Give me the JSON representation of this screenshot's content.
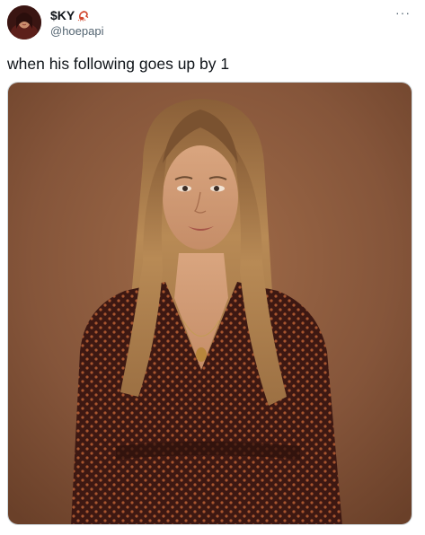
{
  "author": {
    "display_name": "$KY",
    "handle": "@hoepapi",
    "badge_icon": "scorpion-emoji-icon"
  },
  "menu": {
    "more_label": "···"
  },
  "tweet": {
    "text": "when his following goes up by 1"
  },
  "media": {
    "icon": "photo-woman-smiling"
  },
  "colors": {
    "text_primary": "#0f1419",
    "text_secondary": "#536471",
    "background": "#ffffff",
    "photo_background": "#8a5a3c"
  }
}
